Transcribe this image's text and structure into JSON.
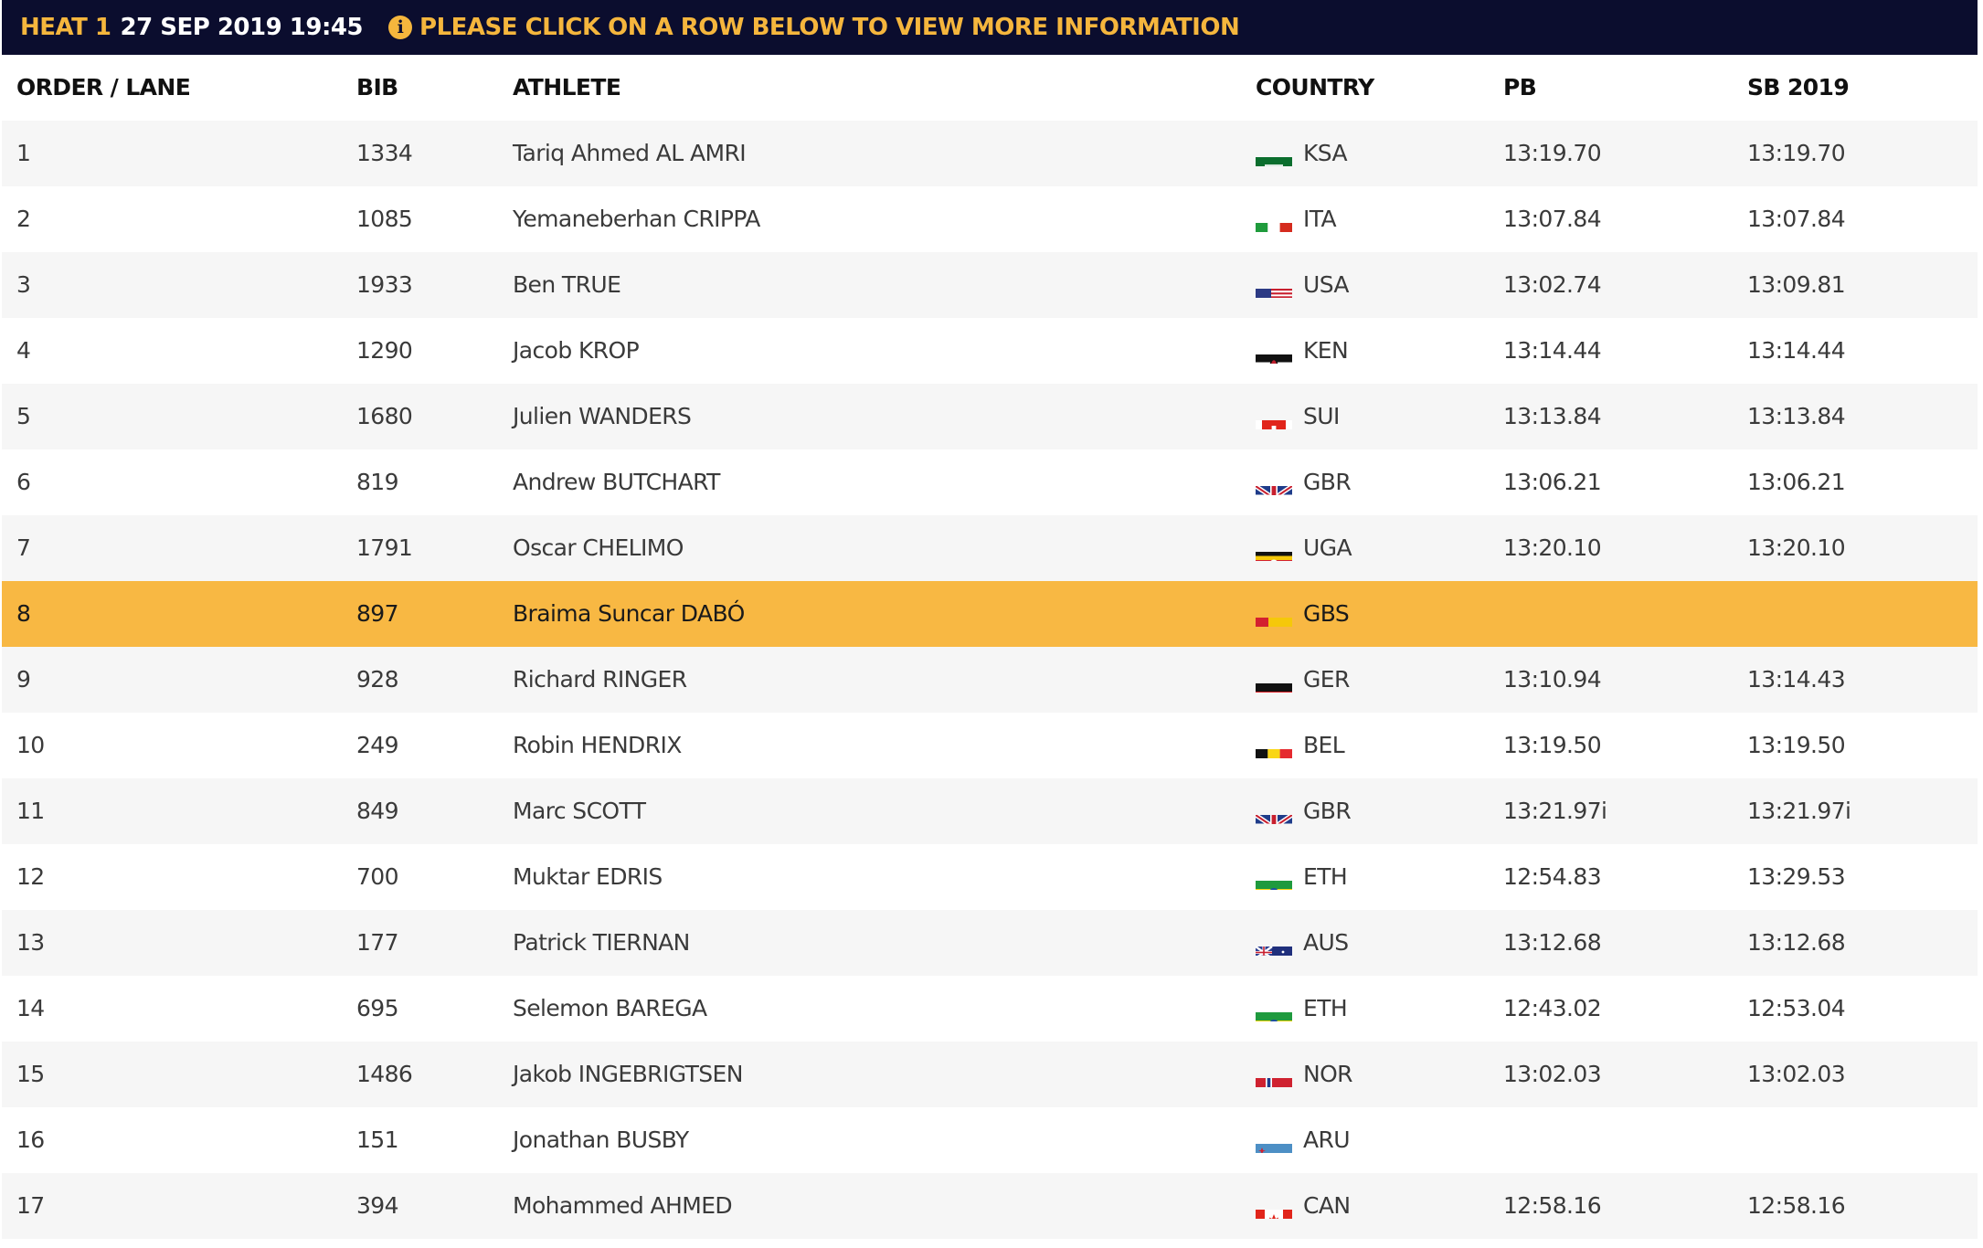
{
  "heat_bar": {
    "heat_label": "HEAT 1",
    "date_time": "27 SEP 2019 19:45",
    "info_text": "PLEASE CLICK ON A ROW BELOW TO VIEW MORE INFORMATION",
    "info_icon_glyph": "i"
  },
  "colors": {
    "header_bg": "#0b0d2e",
    "accent": "#f5b63d",
    "highlight_row": "#f8b843",
    "row_alt": "#f6f6f6"
  },
  "table": {
    "headers": {
      "order": "ORDER / LANE",
      "bib": "BIB",
      "athlete": "ATHLETE",
      "country": "COUNTRY",
      "pb": "PB",
      "sb": "SB 2019"
    },
    "highlighted_order": "8",
    "rows": [
      {
        "order": "1",
        "bib": "1334",
        "athlete": "Tariq Ahmed AL AMRI",
        "country": "KSA",
        "flag": "ksa",
        "pb": "13:19.70",
        "sb": "13:19.70"
      },
      {
        "order": "2",
        "bib": "1085",
        "athlete": "Yemaneberhan CRIPPA",
        "country": "ITA",
        "flag": "ita",
        "pb": "13:07.84",
        "sb": "13:07.84"
      },
      {
        "order": "3",
        "bib": "1933",
        "athlete": "Ben TRUE",
        "country": "USA",
        "flag": "usa",
        "pb": "13:02.74",
        "sb": "13:09.81"
      },
      {
        "order": "4",
        "bib": "1290",
        "athlete": "Jacob KROP",
        "country": "KEN",
        "flag": "ken",
        "pb": "13:14.44",
        "sb": "13:14.44"
      },
      {
        "order": "5",
        "bib": "1680",
        "athlete": "Julien WANDERS",
        "country": "SUI",
        "flag": "sui",
        "pb": "13:13.84",
        "sb": "13:13.84"
      },
      {
        "order": "6",
        "bib": "819",
        "athlete": "Andrew BUTCHART",
        "country": "GBR",
        "flag": "gbr",
        "pb": "13:06.21",
        "sb": "13:06.21"
      },
      {
        "order": "7",
        "bib": "1791",
        "athlete": "Oscar CHELIMO",
        "country": "UGA",
        "flag": "uga",
        "pb": "13:20.10",
        "sb": "13:20.10"
      },
      {
        "order": "8",
        "bib": "897",
        "athlete": "Braima Suncar DABÓ",
        "country": "GBS",
        "flag": "gbs",
        "pb": "",
        "sb": ""
      },
      {
        "order": "9",
        "bib": "928",
        "athlete": "Richard RINGER",
        "country": "GER",
        "flag": "ger",
        "pb": "13:10.94",
        "sb": "13:14.43"
      },
      {
        "order": "10",
        "bib": "249",
        "athlete": "Robin HENDRIX",
        "country": "BEL",
        "flag": "bel",
        "pb": "13:19.50",
        "sb": "13:19.50"
      },
      {
        "order": "11",
        "bib": "849",
        "athlete": "Marc SCOTT",
        "country": "GBR",
        "flag": "gbr",
        "pb": "13:21.97i",
        "sb": "13:21.97i"
      },
      {
        "order": "12",
        "bib": "700",
        "athlete": "Muktar EDRIS",
        "country": "ETH",
        "flag": "eth",
        "pb": "12:54.83",
        "sb": "13:29.53"
      },
      {
        "order": "13",
        "bib": "177",
        "athlete": "Patrick TIERNAN",
        "country": "AUS",
        "flag": "aus",
        "pb": "13:12.68",
        "sb": "13:12.68"
      },
      {
        "order": "14",
        "bib": "695",
        "athlete": "Selemon BAREGA",
        "country": "ETH",
        "flag": "eth",
        "pb": "12:43.02",
        "sb": "12:53.04"
      },
      {
        "order": "15",
        "bib": "1486",
        "athlete": "Jakob INGEBRIGTSEN",
        "country": "NOR",
        "flag": "nor",
        "pb": "13:02.03",
        "sb": "13:02.03"
      },
      {
        "order": "16",
        "bib": "151",
        "athlete": "Jonathan BUSBY",
        "country": "ARU",
        "flag": "aru",
        "pb": "",
        "sb": ""
      },
      {
        "order": "17",
        "bib": "394",
        "athlete": "Mohammed AHMED",
        "country": "CAN",
        "flag": "can",
        "pb": "12:58.16",
        "sb": "12:58.16"
      }
    ]
  }
}
